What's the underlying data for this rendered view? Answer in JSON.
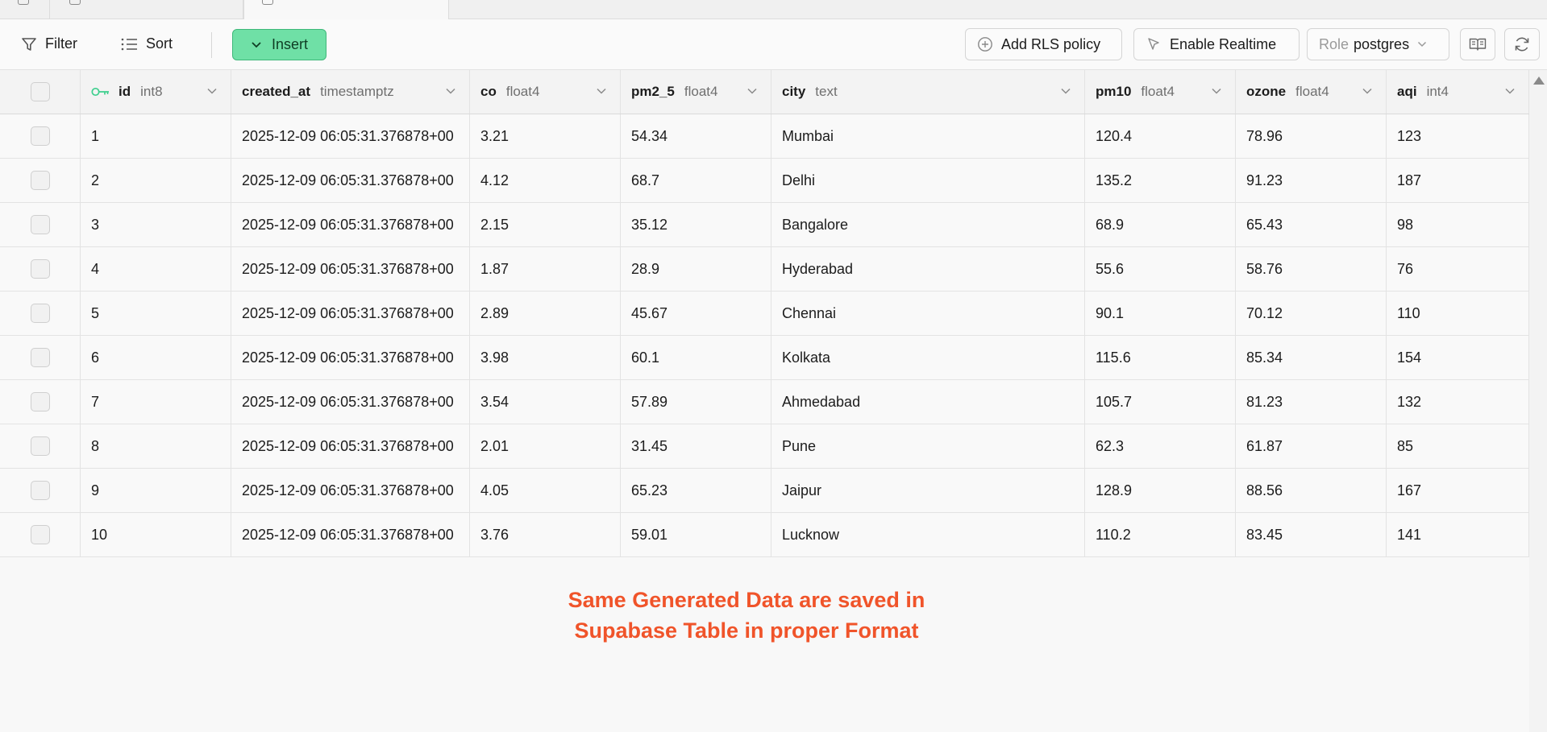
{
  "toolbar": {
    "filter_label": "Filter",
    "sort_label": "Sort",
    "insert_label": "Insert",
    "rls_label": "Add RLS policy",
    "realtime_label": "Enable Realtime",
    "role_prefix": "Role",
    "role_value": "postgres"
  },
  "table": {
    "columns": [
      {
        "name": "id",
        "type": "int8",
        "primary_key": true
      },
      {
        "name": "created_at",
        "type": "timestamptz"
      },
      {
        "name": "co",
        "type": "float4"
      },
      {
        "name": "pm2_5",
        "type": "float4"
      },
      {
        "name": "city",
        "type": "text"
      },
      {
        "name": "pm10",
        "type": "float4"
      },
      {
        "name": "ozone",
        "type": "float4"
      },
      {
        "name": "aqi",
        "type": "int4"
      }
    ],
    "rows": [
      [
        "1",
        "2025-12-09 06:05:31.376878+00",
        "3.21",
        "54.34",
        "Mumbai",
        "120.4",
        "78.96",
        "123"
      ],
      [
        "2",
        "2025-12-09 06:05:31.376878+00",
        "4.12",
        "68.7",
        "Delhi",
        "135.2",
        "91.23",
        "187"
      ],
      [
        "3",
        "2025-12-09 06:05:31.376878+00",
        "2.15",
        "35.12",
        "Bangalore",
        "68.9",
        "65.43",
        "98"
      ],
      [
        "4",
        "2025-12-09 06:05:31.376878+00",
        "1.87",
        "28.9",
        "Hyderabad",
        "55.6",
        "58.76",
        "76"
      ],
      [
        "5",
        "2025-12-09 06:05:31.376878+00",
        "2.89",
        "45.67",
        "Chennai",
        "90.1",
        "70.12",
        "110"
      ],
      [
        "6",
        "2025-12-09 06:05:31.376878+00",
        "3.98",
        "60.1",
        "Kolkata",
        "115.6",
        "85.34",
        "154"
      ],
      [
        "7",
        "2025-12-09 06:05:31.376878+00",
        "3.54",
        "57.89",
        "Ahmedabad",
        "105.7",
        "81.23",
        "132"
      ],
      [
        "8",
        "2025-12-09 06:05:31.376878+00",
        "2.01",
        "31.45",
        "Pune",
        "62.3",
        "61.87",
        "85"
      ],
      [
        "9",
        "2025-12-09 06:05:31.376878+00",
        "4.05",
        "65.23",
        "Jaipur",
        "128.9",
        "88.56",
        "167"
      ],
      [
        "10",
        "2025-12-09 06:05:31.376878+00",
        "3.76",
        "59.01",
        "Lucknow",
        "110.2",
        "83.45",
        "141"
      ]
    ]
  },
  "annotation": {
    "line1": "Same Generated Data are saved in",
    "line2": "Supabase Table in proper Format"
  },
  "colors": {
    "insert_bg": "#6fe0a6",
    "key_icon": "#3ecf8e",
    "annotation": "#f0542a"
  },
  "icons": {
    "filter": "filter-icon",
    "sort": "sort-icon",
    "insert_chevron": "chevron-down-icon",
    "rls": "plus-circle-icon",
    "realtime": "cursor-icon",
    "docs": "book-icon",
    "refresh": "refresh-icon",
    "primary_key": "key-icon"
  }
}
